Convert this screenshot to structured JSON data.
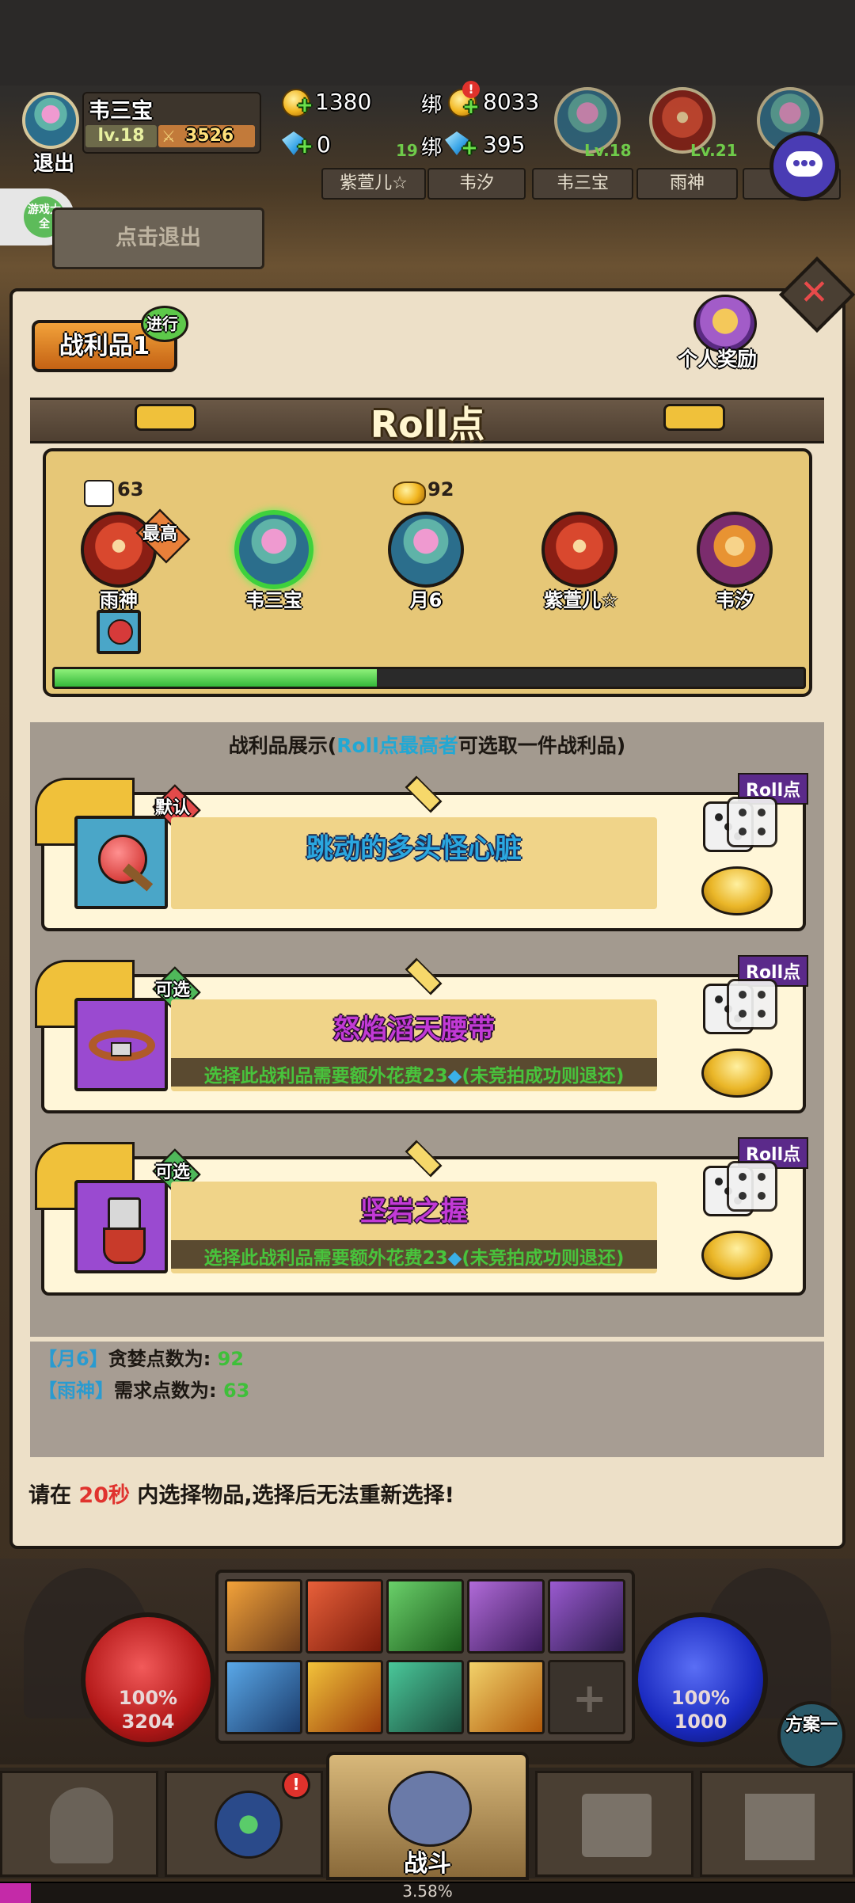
{
  "header": {
    "player_name": "韦三宝",
    "level": "lv.18",
    "power": "3526",
    "exit_label": "退出",
    "gold": "1380",
    "gem": "0",
    "bound_label": "绑",
    "bound_gold": "8033",
    "bound_gem": "395",
    "bound_gold_alert": "!",
    "teammates": [
      "紫萱儿☆",
      "韦汐",
      "韦三宝",
      "雨神"
    ],
    "teammate_levels": [
      "19",
      "Lv.18",
      "Lv.21"
    ]
  },
  "game_center": {
    "label": "游戏大全",
    "exit_hint": "点击退出"
  },
  "panel": {
    "loot_tab": "战利品1",
    "status_badge": "进行",
    "personal_reward": "个人奖励",
    "roll_title": "Roll点",
    "dice_score_high": "63",
    "gold_score_high": "92",
    "highest_badge": "最高",
    "players": [
      {
        "name": "雨神",
        "avatar": "red"
      },
      {
        "name": "韦三宝",
        "avatar": "teal"
      },
      {
        "name": "月6",
        "avatar": "teal"
      },
      {
        "name": "紫萱儿☆",
        "avatar": "red"
      },
      {
        "name": "韦汐",
        "avatar": "orange"
      }
    ],
    "progress": 0.43,
    "loot_display_prefix": "战利品展示(",
    "loot_display_highlight": "Roll点最高者",
    "loot_display_suffix": "可选取一件战利品)",
    "items": [
      {
        "tag": "默认",
        "name": "跳动的多头怪心脏",
        "roll_tag": "Roll点",
        "cost": "",
        "name_color": "#2aa7e0",
        "icon": "heart-potion-icon"
      },
      {
        "tag": "可选",
        "name": "怒焰滔天腰带",
        "roll_tag": "Roll点",
        "cost": "选择此战利品需要额外花费23",
        "cost_note": "(未竞拍成功则退还)",
        "name_color": "#c23ad6",
        "icon": "belt-icon"
      },
      {
        "tag": "可选",
        "name": "坚岩之握",
        "roll_tag": "Roll点",
        "cost": "选择此战利品需要额外花费23",
        "cost_note": "(未竞拍成功则退还)",
        "name_color": "#c23ad6",
        "icon": "gauntlet-icon"
      }
    ],
    "log": [
      {
        "name": "【月6】",
        "text": "贪婪点数为:",
        "value": "92"
      },
      {
        "name": "【雨神】",
        "text": "需求点数为:",
        "value": "63"
      }
    ],
    "timer_prefix": "请在",
    "timer_seconds": "20秒",
    "timer_suffix": "内选择物品,选择后无法重新选择!"
  },
  "hud": {
    "hp_percent": "100%",
    "hp_value": "3204",
    "mp_percent": "100%",
    "mp_value": "1000",
    "scheme_label": "方案一",
    "battle_label": "战斗",
    "exp_percent": "3.58%",
    "nav_alert": "!"
  }
}
